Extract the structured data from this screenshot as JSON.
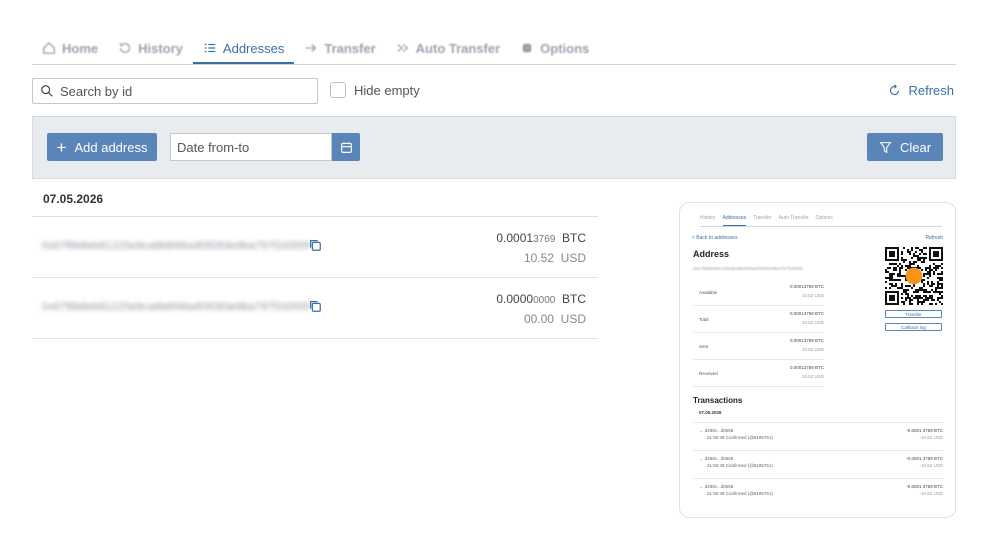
{
  "tabs": [
    {
      "label": "Home",
      "icon": "home-icon"
    },
    {
      "label": "History",
      "icon": "history-icon"
    },
    {
      "label": "Addresses",
      "icon": "list-icon",
      "active": true
    },
    {
      "label": "Transfer",
      "icon": "arrow-right-icon"
    },
    {
      "label": "Auto Transfer",
      "icon": "fast-forward-icon"
    },
    {
      "label": "Options",
      "icon": "gear-icon"
    }
  ],
  "search": {
    "placeholder": "Search by id"
  },
  "hide_empty_label": "Hide empty",
  "refresh_label": "Refresh",
  "toolbar": {
    "add_label": "Add address",
    "date_placeholder": "Date from-to",
    "clear_label": "Clear"
  },
  "list": {
    "date": "07.05.2026",
    "rows": [
      {
        "address": "0x67f6b8eb81225e9ca6b6f46a4f3f283e9ba797f2d355f",
        "btc_main": "0.0001",
        "btc_small": "3769",
        "btc_unit": "BTC",
        "fiat": "10.52",
        "fiat_unit": "USD"
      },
      {
        "address": "0x67f6b8eb81225e9ca6b6f46a4f3f283e9ba797f2d355f",
        "btc_main": "0.0000",
        "btc_small": "0000",
        "btc_unit": "BTC",
        "fiat": "00.00",
        "fiat_unit": "USD"
      }
    ]
  },
  "preview": {
    "tabs": [
      "History",
      "Addresses",
      "Transfer",
      "Auto Transfer",
      "Options"
    ],
    "back": "< Back to addresses",
    "refresh": "Refresh",
    "title": "Address",
    "address": "0x67f6b8eb81225e9ca6b6f46a4f3f283e9ba797f2d355f",
    "transfer_btn": "Transfer",
    "callback_btn": "Callback log",
    "balances": [
      {
        "label": "Available",
        "btc": "0.0001",
        "small": "3769",
        "unit": "BTC",
        "fiat": "10.52",
        "fiat_unit": "USD"
      },
      {
        "label": "Total",
        "btc": "0.0001",
        "small": "3769",
        "unit": "BTC",
        "fiat": "10.52",
        "fiat_unit": "USD"
      },
      {
        "label": "Sent",
        "btc": "0.0001",
        "small": "3769",
        "unit": "BTC",
        "fiat": "10.52",
        "fiat_unit": "USD"
      },
      {
        "label": "Received",
        "btc": "0.0001",
        "small": "3769",
        "unit": "BTC",
        "fiat": "10.52",
        "fiat_unit": "USD"
      }
    ],
    "transactions_title": "Transactions",
    "tx_date": "07.05.2026",
    "transactions": [
      {
        "hash": "d298c...d9558",
        "time": "21:50:48",
        "status": "Confirmed",
        "block": "(@8185751)",
        "btc": "-0.0001",
        "small": "3769",
        "unit": "BTC",
        "fiat": "-10.52",
        "fiat_unit": "USD"
      },
      {
        "hash": "d298c...d9558",
        "time": "21:50:48",
        "status": "Confirmed",
        "block": "(@8185751)",
        "btc": "-0.0001",
        "small": "3769",
        "unit": "BTC",
        "fiat": "-10.52",
        "fiat_unit": "USD"
      },
      {
        "hash": "d298c...d9558",
        "time": "21:50:48",
        "status": "Confirmed",
        "block": "(@8185751)",
        "btc": "-0.0001",
        "small": "3769",
        "unit": "BTC",
        "fiat": "-10.52",
        "fiat_unit": "USD"
      }
    ]
  },
  "colors": {
    "accent": "#3d6fa6",
    "button": "#5a85b8",
    "toolbar_bg": "#e9ecef",
    "bitcoin": "#f7931a"
  }
}
